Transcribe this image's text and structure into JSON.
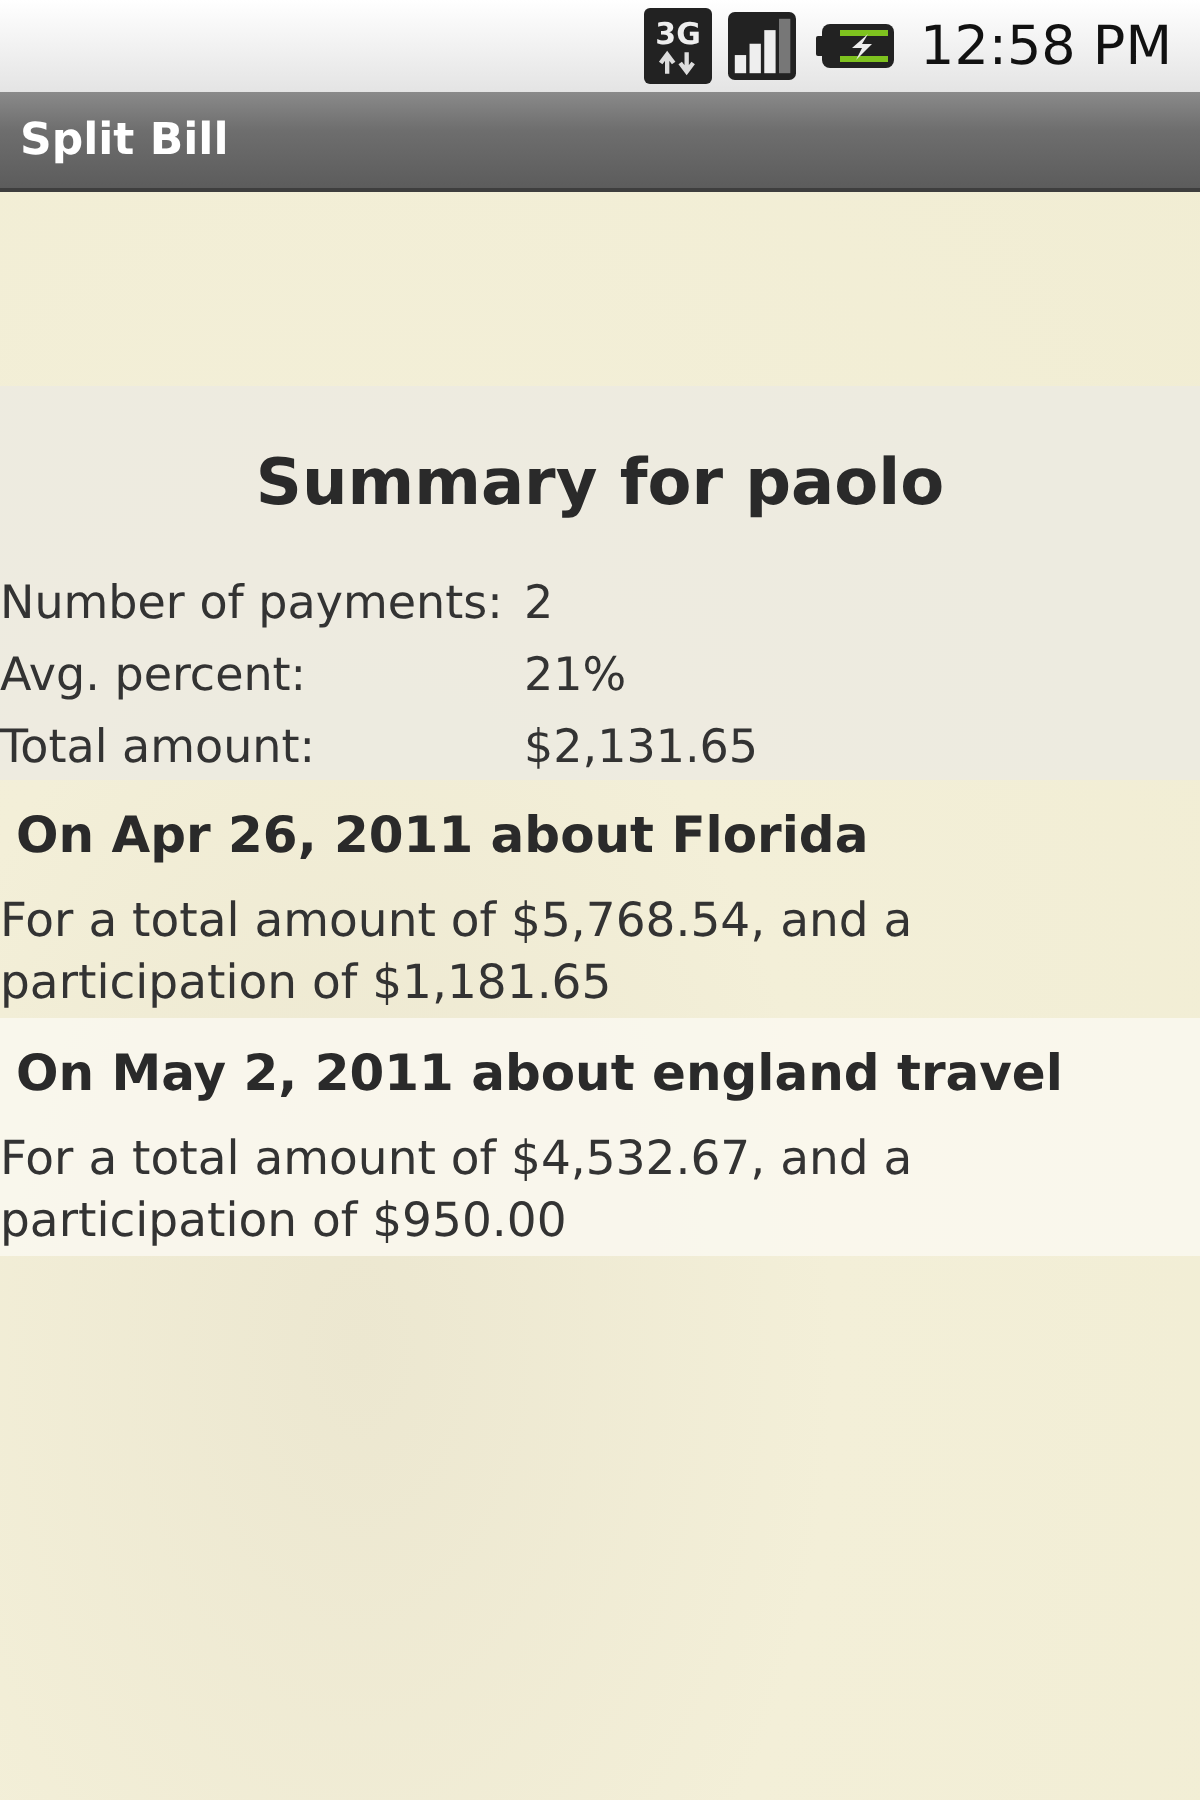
{
  "status_bar": {
    "network": "3G",
    "time": "12:58 PM"
  },
  "app_bar": {
    "title": "Split Bill"
  },
  "summary": {
    "title": "Summary for paolo",
    "stats": [
      {
        "label": "Number of payments:",
        "value": "2"
      },
      {
        "label": "Avg. percent:",
        "value": "21%"
      },
      {
        "label": "Total amount:",
        "value": "$2,131.65"
      }
    ]
  },
  "payments": [
    {
      "heading": "On Apr 26, 2011 about Florida",
      "details": "For a total amount of $5,768.54, and a participation of $1,181.65"
    },
    {
      "heading": "On May 2, 2011 about england travel",
      "details": "For a total amount of $4,532.67, and a participation of $950.00"
    }
  ]
}
